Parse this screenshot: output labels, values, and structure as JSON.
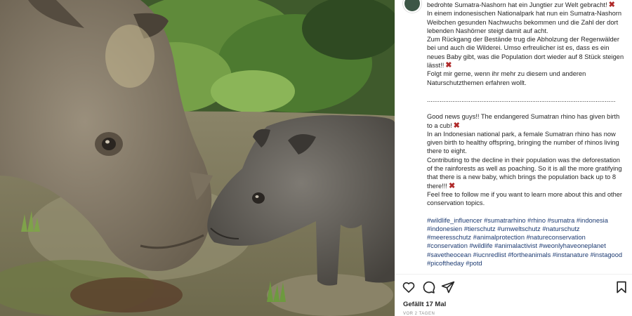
{
  "post": {
    "caption_de": [
      "bedrohte Sumatra-Nashorn hat ein Jungtier zur Welt gebracht!",
      "In einem indonesischen Nationalpark hat nun ein Sumatra-Nashorn Weibchen gesunden Nachwuchs bekommen und die Zahl der dort lebenden Nashörner steigt damit auf acht.",
      "Zum Rückgang der Bestände trug die Abholzung der Regenwälder bei und auch die Wilderei. Umso erfreulicher ist es, dass es ein neues Baby gibt, was die Population dort wieder auf 8 Stück steigen lässt!!",
      "Folgt mir gerne, wenn ihr mehr zu diesem und anderen Naturschutzthemen erfahren wollt."
    ],
    "separator": "........................................................................................................",
    "caption_en": [
      "Good news guys!! The endangered Sumatran rhino has given birth to a cub!",
      "In an Indonesian national park, a female Sumatran rhino has now given birth to healthy offspring, bringing the number of rhinos living there to eight.",
      "Contributing to the decline in their population was the deforestation of the rainforests as well as poaching. So it is all the more gratifying that there is a new baby, which brings the population back up to 8 there!!!",
      "Feel free to follow me if you want to learn more about this and other conservation topics."
    ],
    "hashtags": "#wildlife_influencer #sumatrarhino #rhino #sumatra #indonesia #indonesien #tierschutz #umweltschutz #naturschutz #meeresschutz #animalprotection #natureconservation #conservation #wildlife #animalactivist #weonlyhaveoneplanet #savetheocean #iucnredlist #fortheanimals #instanature #instagood #picoftheday #potd",
    "likes_text": "Gefällt 17 Mal",
    "date_text": "VOR 2 TAGEN"
  },
  "icons": [
    "heart-icon",
    "comment-icon",
    "share-icon",
    "bookmark-icon",
    "cross-mark-icon"
  ],
  "colors": {
    "hashtag": "#1d3b72",
    "cross_mark": "#b02a2a",
    "muted": "#8e8e8e"
  }
}
